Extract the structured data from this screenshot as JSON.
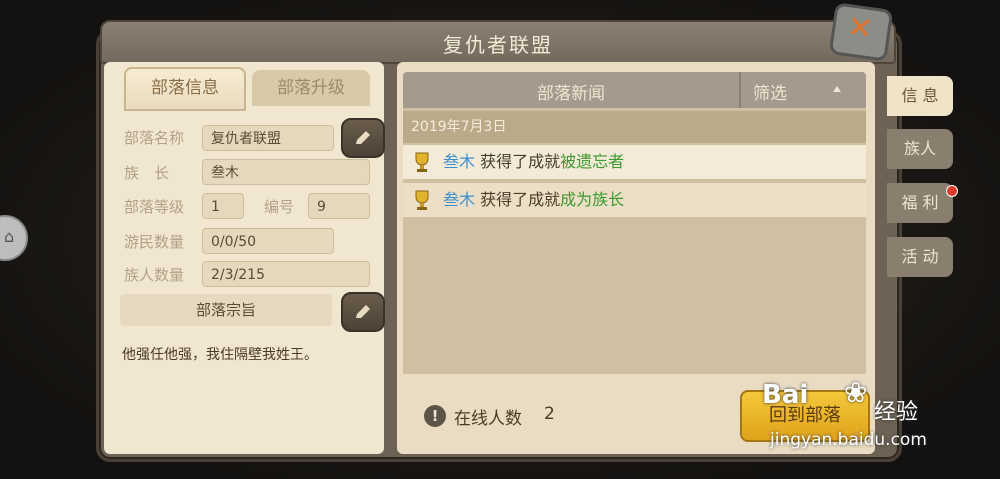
{
  "title": "复仇者联盟",
  "tabs": {
    "info": "部落信息",
    "upgrade": "部落升级"
  },
  "fields": {
    "name_label": "部落名称",
    "name_value": "复仇者联盟",
    "chief_label": "族　长",
    "chief_value": "叁木",
    "level_label": "部落等级",
    "level_value": "1",
    "id_label": "编号",
    "id_value": "9",
    "nomad_label": "游民数量",
    "nomad_value": "0/0/50",
    "member_label": "族人数量",
    "member_value": "2/3/215"
  },
  "purpose": {
    "label": "部落宗旨",
    "text": "他强任他强，我住隔壁我姓王。"
  },
  "news": {
    "title": "部落新闻",
    "filter": "筛选",
    "date": "2019年7月3日",
    "items": [
      {
        "who": "叁木",
        "verb": " 获得了成就",
        "what": "被遗忘者"
      },
      {
        "who": "叁木",
        "verb": " 获得了成就",
        "what": "成为族长"
      }
    ]
  },
  "online": {
    "label": "在线人数",
    "count": "2"
  },
  "return_label": "回到部落",
  "side_tabs": [
    "信 息",
    "族人",
    "福 利",
    "活 动"
  ],
  "watermark": {
    "logo": "Bai",
    "cn": "经验",
    "url": "jingyan.baidu.com"
  },
  "colors": {
    "news_who": "#3b8fcf",
    "news_what": "#3c9a2e",
    "button": "#f5c83b"
  }
}
